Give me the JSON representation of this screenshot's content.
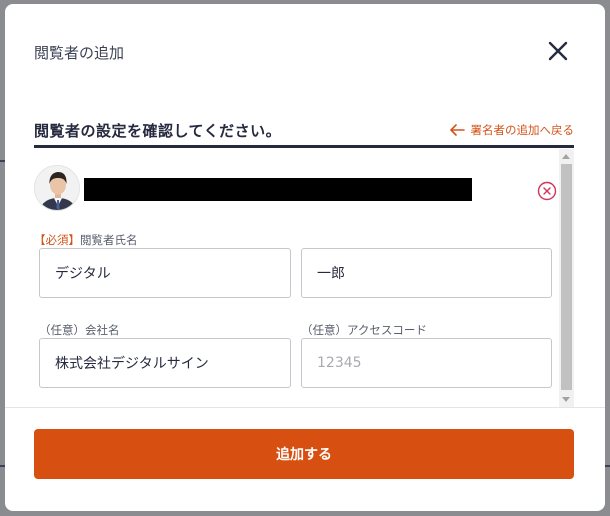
{
  "modal": {
    "title": "閲覧者の追加",
    "close_icon": "close-icon"
  },
  "section": {
    "title": "閲覧者の設定を確認してください。",
    "back_link": "署名者の追加へ戻る",
    "back_icon": "arrow-left-icon"
  },
  "viewer": {
    "avatar": "avatar",
    "name_redacted": "",
    "remove_icon": "circle-x-icon",
    "required_tag": "【必須】",
    "name_label": "閲覧者氏名",
    "last_name": "デジタル",
    "first_name": "一郎",
    "company_label": "（任意）会社名",
    "company": "株式会社デジタルサイン",
    "access_code_label": "（任意）アクセスコード",
    "access_code_placeholder": "12345",
    "access_code_value": ""
  },
  "footer": {
    "submit_label": "追加する"
  },
  "colors": {
    "accent": "#d84f12",
    "heading": "#262a3f",
    "danger": "#d4325b"
  }
}
